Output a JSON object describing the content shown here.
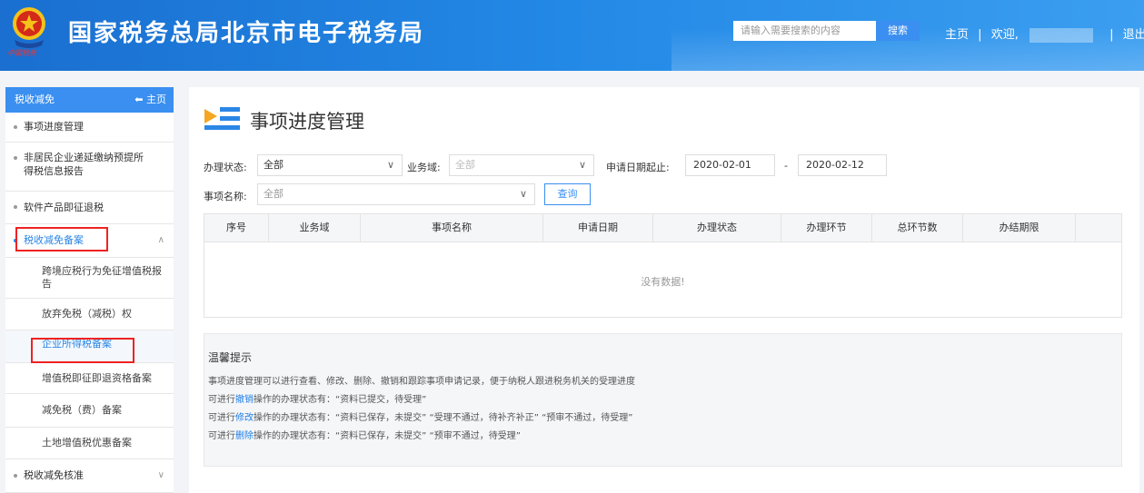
{
  "header": {
    "title": "国家税务总局北京市电子税务局",
    "search_placeholder": "请输入需要搜索的内容",
    "search_button": "搜索",
    "home_link": "主页",
    "welcome": "欢迎,",
    "logout": "退出",
    "emblem_caption": "中国税务"
  },
  "sidebar": {
    "section_title": "税收减免",
    "home_label": "主页",
    "items": [
      {
        "label": "事项进度管理"
      },
      {
        "label": "非居民企业递延缴纳预提所得税信息报告"
      },
      {
        "label": "软件产品即征退税"
      },
      {
        "label": "税收减免备案",
        "expanded": true
      },
      {
        "label": "税收减免核准"
      }
    ],
    "subitems": [
      {
        "label": "跨境应税行为免征增值税报告"
      },
      {
        "label": "放弃免税（减税）权"
      },
      {
        "label": "企业所得税备案",
        "active": true
      },
      {
        "label": "增值税即征即退资格备案"
      },
      {
        "label": "减免税（费）备案"
      },
      {
        "label": "土地增值税优惠备案"
      }
    ]
  },
  "main": {
    "page_title": "事项进度管理",
    "filters": {
      "status_label": "办理状态:",
      "status_value": "全部",
      "domain_label": "业务域:",
      "domain_value": "全部",
      "date_label": "申请日期起止:",
      "date_from": "2020-02-01",
      "date_sep": "-",
      "date_to": "2020-02-12",
      "name_label": "事项名称:",
      "name_value": "全部",
      "query_button": "查询"
    },
    "table": {
      "columns": [
        "序号",
        "业务域",
        "事项名称",
        "申请日期",
        "办理状态",
        "办理环节",
        "总环节数",
        "办结期限"
      ],
      "empty_text": "没有数据!"
    },
    "tips": {
      "title": "温馨提示",
      "line1": "事项进度管理可以进行查看、修改、删除、撤销和跟踪事项申请记录，便于纳税人跟进税务机关的受理进度",
      "line2_pre": "可进行",
      "line2_kw": "撤销",
      "line2_post": "操作的办理状态有：“资料已提交，待受理”",
      "line3_pre": "可进行",
      "line3_kw": "修改",
      "line3_post": "操作的办理状态有：“资料已保存，未提交”  “受理不通过，待补齐补正”  “预审不通过，待受理”",
      "line4_pre": "可进行",
      "line4_kw": "删除",
      "line4_post": "操作的办理状态有：“资料已保存，未提交”  “预审不通过，待受理”"
    }
  },
  "colors": {
    "header_blue": "#2389e6",
    "accent": "#3a8ff0",
    "highlight": "#e22222"
  }
}
